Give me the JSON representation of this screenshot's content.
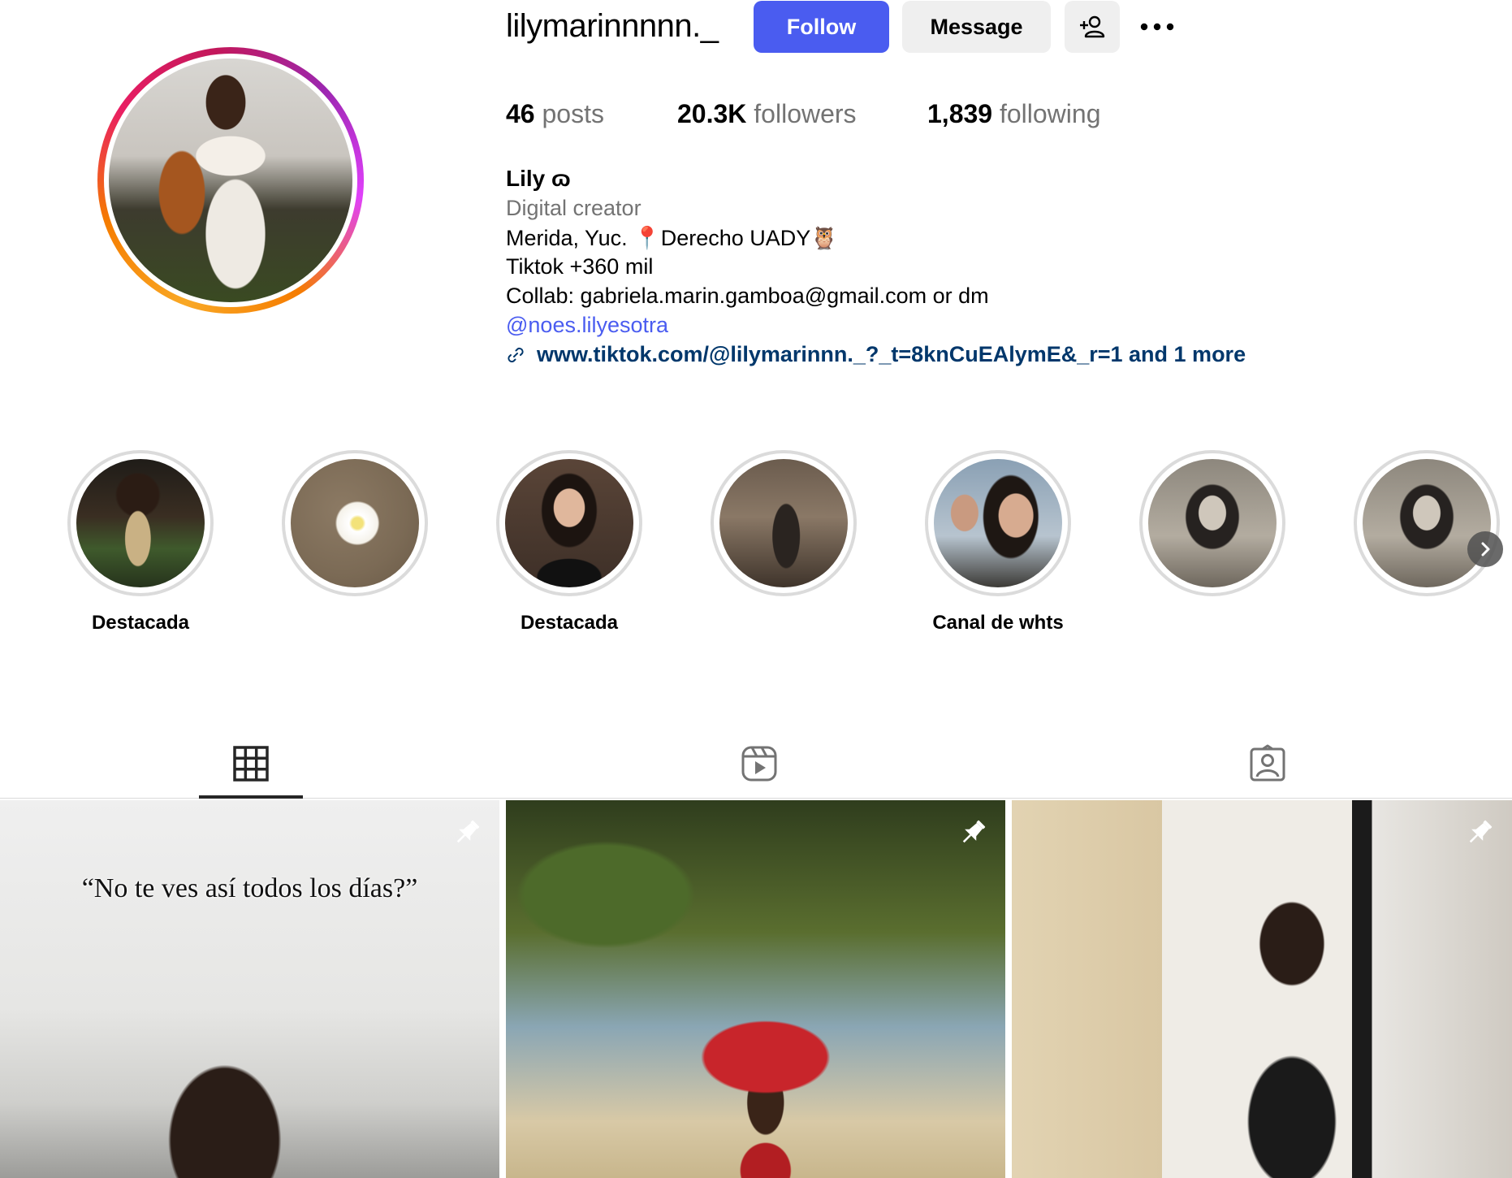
{
  "profile": {
    "username": "lilymarinnnnn._",
    "follow_label": "Follow",
    "message_label": "Message",
    "stats": {
      "posts_count": "46",
      "posts_label": "posts",
      "followers_count": "20.3K",
      "followers_label": "followers",
      "following_count": "1,839",
      "following_label": "following"
    },
    "bio": {
      "name": "Lily ɷ",
      "category": "Digital creator",
      "line1": "Merida, Yuc. 📍Derecho UADY🦉",
      "line2": "Tiktok +360 mil",
      "line3": "Collab: gabriela.marin.gamboa@gmail.com or dm",
      "mention": "@noes.lilyesotra",
      "link": "www.tiktok.com/@lilymarinnn._?_t=8knCuEAlymE&_r=1 and 1 more"
    }
  },
  "highlights": [
    {
      "label": "Destacada"
    },
    {
      "label": ""
    },
    {
      "label": "Destacada"
    },
    {
      "label": ""
    },
    {
      "label": "Canal de whts"
    },
    {
      "label": ""
    },
    {
      "label": ""
    }
  ],
  "tabs": [
    {
      "icon": "grid-icon",
      "active": true
    },
    {
      "icon": "reels-icon",
      "active": false
    },
    {
      "icon": "tagged-icon",
      "active": false
    }
  ],
  "posts": [
    {
      "caption": "“No te ves así todos los días?”",
      "pinned": true
    },
    {
      "caption": "",
      "pinned": true
    },
    {
      "caption": "",
      "pinned": true
    }
  ],
  "colors": {
    "primary_button": "#4a5cf0",
    "secondary_button": "#efefef",
    "muted_text": "#737373",
    "link_text": "#00376b",
    "mention_text": "#4a5cf0"
  }
}
